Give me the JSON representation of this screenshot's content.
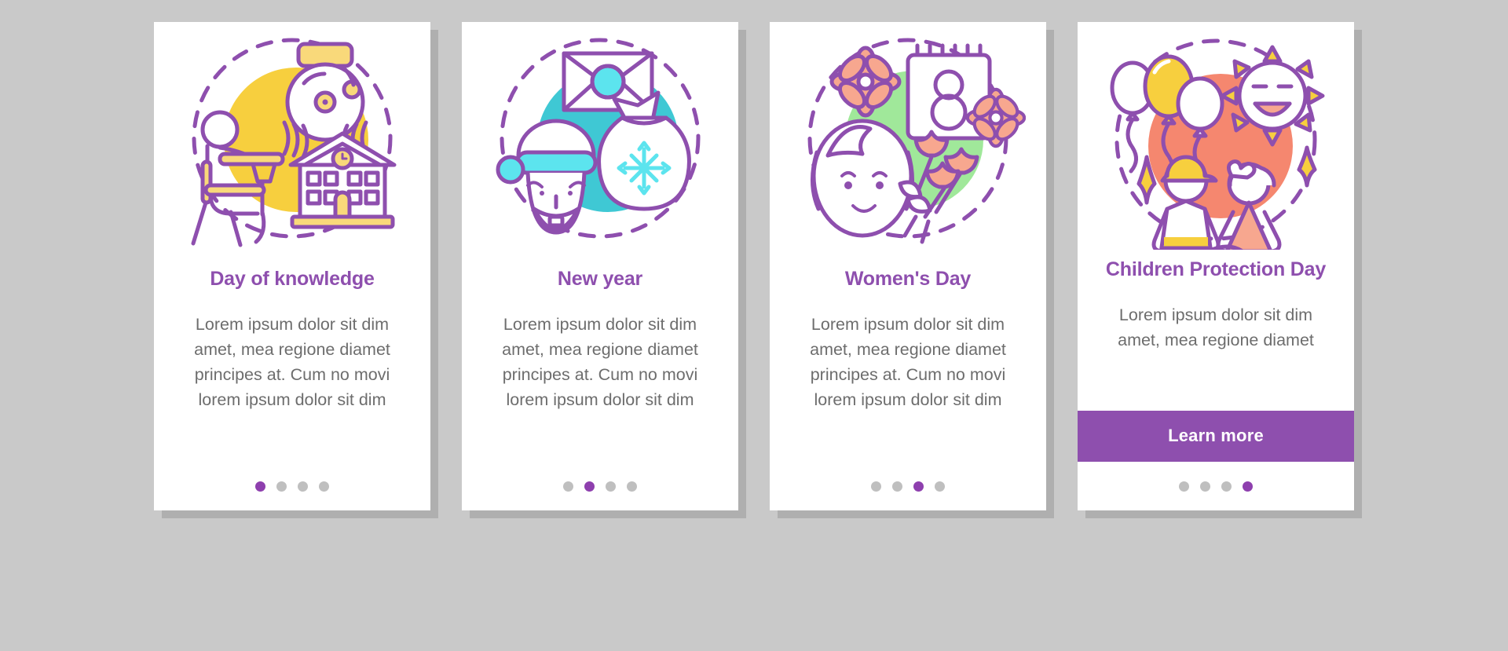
{
  "page": {
    "background_color": "#c9c9c9",
    "card_background": "#ffffff",
    "title_color": "#8e4fae",
    "body_color": "#6d6d6d",
    "accent_color": "#8e4fae",
    "dot_inactive_color": "#bfbfbf",
    "dot_active_color": "#8e3fae"
  },
  "cards": [
    {
      "illustration_name": "day-of-knowledge-illustration",
      "illustration_circle_color": "#f7cf3e",
      "title": "Day of knowledge",
      "body": "Lorem ipsum dolor sit dim amet, mea regione diamet principes at. Cum no movi lorem ipsum dolor sit dim",
      "dots_total": 4,
      "dots_active_index": 0,
      "has_cta": false,
      "cta_label": ""
    },
    {
      "illustration_name": "new-year-illustration",
      "illustration_circle_color": "#3fc8d4",
      "title": "New year",
      "body": "Lorem ipsum dolor sit dim amet, mea regione diamet principes at. Cum no movi lorem ipsum dolor sit dim",
      "dots_total": 4,
      "dots_active_index": 1,
      "has_cta": false,
      "cta_label": ""
    },
    {
      "illustration_name": "womens-day-illustration",
      "illustration_circle_color": "#a0e89a",
      "title": "Women's Day",
      "body": "Lorem ipsum dolor sit dim amet, mea regione diamet principes at. Cum no movi lorem ipsum dolor sit dim",
      "dots_total": 4,
      "dots_active_index": 2,
      "has_cta": false,
      "cta_label": ""
    },
    {
      "illustration_name": "children-protection-day-illustration",
      "illustration_circle_color": "#f5876f",
      "title": "Children Protection Day",
      "body": "Lorem ipsum dolor sit dim amet, mea regione diamet",
      "dots_total": 4,
      "dots_active_index": 3,
      "has_cta": true,
      "cta_label": "Learn more"
    }
  ]
}
